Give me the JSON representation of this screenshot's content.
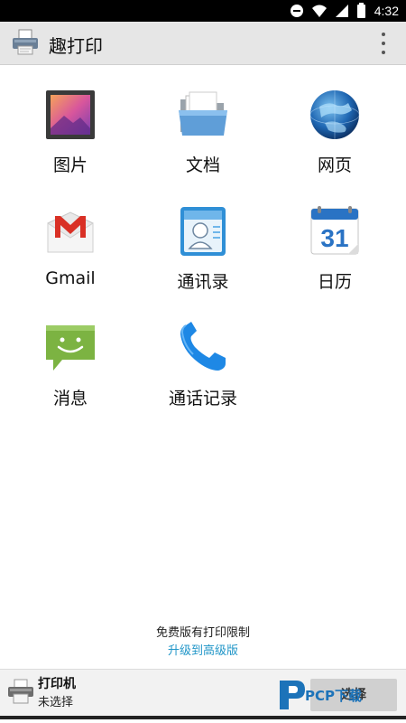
{
  "status_bar": {
    "time": "4:32"
  },
  "app_bar": {
    "title": "趣打印"
  },
  "grid": [
    {
      "label": "图片",
      "icon": "gallery-icon"
    },
    {
      "label": "文档",
      "icon": "folder-icon"
    },
    {
      "label": "网页",
      "icon": "globe-icon"
    },
    {
      "label": "Gmail",
      "icon": "gmail-icon"
    },
    {
      "label": "通讯录",
      "icon": "contacts-icon"
    },
    {
      "label": "日历",
      "icon": "calendar-icon"
    },
    {
      "label": "消息",
      "icon": "messaging-icon"
    },
    {
      "label": "通话记录",
      "icon": "phone-icon"
    }
  ],
  "calendar_day": "31",
  "notice": {
    "text": "免费版有打印限制",
    "upgrade": "升级到高级版"
  },
  "bottom_bar": {
    "printer_title": "打印机",
    "printer_status": "未选择",
    "select_label": "选择",
    "watermark": "PCP下载"
  },
  "colors": {
    "accent": "#2196c8",
    "appbar": "#e6e6e6"
  }
}
